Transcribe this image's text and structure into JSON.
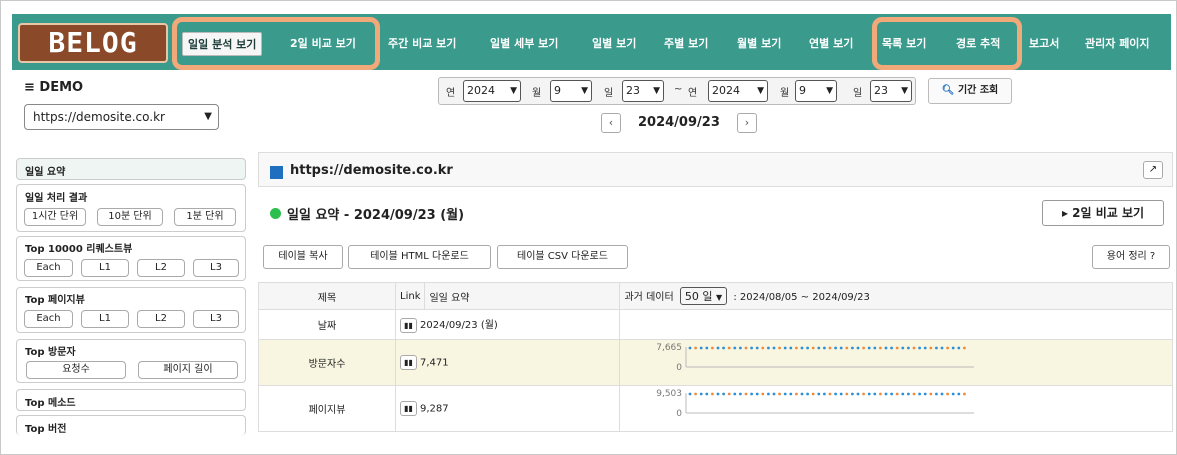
{
  "logo": "BELOG",
  "nav": {
    "items": [
      "일일 분석 보기",
      "2일 비교 보기",
      "주간 비교 보기",
      "일별 세부 보기",
      "일별 보기",
      "주별 보기",
      "월별 보기",
      "연별 보기",
      "목록 보기",
      "경로 추적",
      "보고서",
      "관리자 페이지"
    ]
  },
  "header": {
    "demo_label": "≡ DEMO",
    "site_select": "https://demosite.co.kr",
    "from": {
      "year_label": "연",
      "year": "2024",
      "month_label": "월",
      "month": "9",
      "day_label": "일",
      "day": "23"
    },
    "tilde": "~",
    "to": {
      "year_label": "연",
      "year": "2024",
      "month_label": "월",
      "month": "9",
      "day_label": "일",
      "day": "23"
    },
    "period_button": "기간 조회",
    "prev": "‹",
    "next": "›",
    "current_date": "2024/09/23"
  },
  "sidebar": {
    "daily_summary": "일일 요약",
    "processing": {
      "title": "일일 처리 결과",
      "buttons": [
        "1시간 단위",
        "10분 단위",
        "1분 단위"
      ]
    },
    "top_request": {
      "title": "Top 10000 리퀘스트뷰",
      "buttons": [
        "Each",
        "L1",
        "L2",
        "L3"
      ]
    },
    "top_pageview": {
      "title": "Top 페이지뷰",
      "buttons": [
        "Each",
        "L1",
        "L2",
        "L3"
      ]
    },
    "top_visitor": {
      "title": "Top 방문자",
      "buttons": [
        "요청수",
        "페이지 길이"
      ]
    },
    "top_method": "Top 메소드",
    "top_version": "Top 버전"
  },
  "main": {
    "site_title": "https://demosite.co.kr",
    "expand": "↗",
    "daily_title": "일일 요약 - 2024/09/23 (월)",
    "compare_button": "▸ 2일 비교 보기",
    "table_buttons": [
      "테이블 복사",
      "테이블 HTML 다운로드",
      "테이블 CSV 다운로드"
    ],
    "glossary_button": "용어 정리 ?",
    "table": {
      "col_title": "제목",
      "col_link": "Link",
      "col_summary": "일일 요약",
      "past_label": "과거 데이터",
      "past_select": "50 일",
      "past_range": ": 2024/08/05 ~ 2024/09/23",
      "rows": [
        {
          "label": "날짜",
          "value": "2024/09/23 (월)"
        },
        {
          "label": "방문자수",
          "value": "7,471",
          "spark_max": "7,665",
          "spark_min": "0"
        },
        {
          "label": "페이지뷰",
          "value": "9,287",
          "spark_max": "9,503",
          "spark_min": "0"
        }
      ]
    }
  }
}
